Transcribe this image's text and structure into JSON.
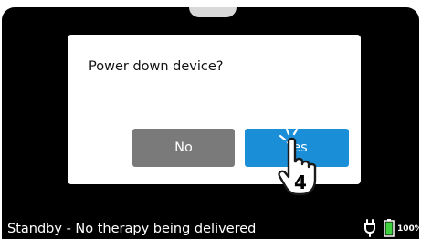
{
  "dialog": {
    "message": "Power down device?",
    "no_label": "No",
    "yes_label": "Yes"
  },
  "cursor": {
    "step_number": "4",
    "icon": "hand-pointer-icon"
  },
  "status_bar": {
    "status_text": "Standby - No therapy being delivered",
    "plug_icon": "power-plug-icon",
    "battery_icon": "battery-icon",
    "battery_percent": "100%",
    "battery_level": 1.0
  },
  "colors": {
    "screen_bg": "#000000",
    "dialog_bg": "#ffffff",
    "no_button": "#7a7a7a",
    "yes_button": "#1a8fd8",
    "battery_fill": "#3fcf3f"
  }
}
